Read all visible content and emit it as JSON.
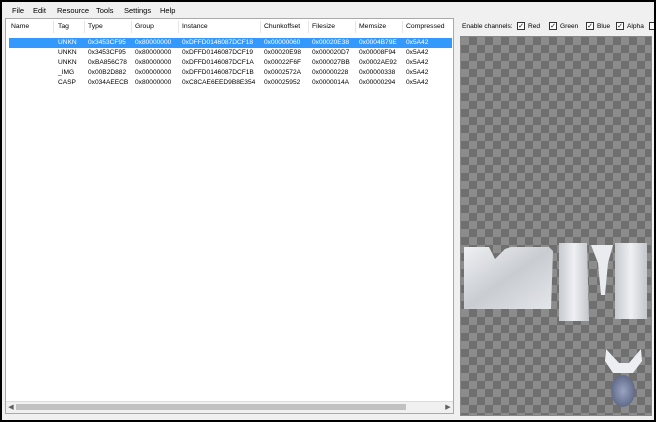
{
  "menu": [
    "File",
    "Edit",
    "Resource",
    "Tools",
    "Settings",
    "Help"
  ],
  "table": {
    "columns": [
      "Name",
      "Tag",
      "Type",
      "Group",
      "Instance",
      "Chunkoffset",
      "Filesize",
      "Memsize",
      "Compressed"
    ],
    "rows": [
      {
        "name": "",
        "tag": "UNKN",
        "type": "0x3453CF95",
        "group": "0x80000000",
        "instance": "0xDFFD0146087DCF18",
        "chunkoffset": "0x00000060",
        "filesize": "0x00020E38",
        "memsize": "0x0004B79E",
        "compressed": "0x5A42",
        "selected": true
      },
      {
        "name": "",
        "tag": "UNKN",
        "type": "0x3453CF95",
        "group": "0x80000000",
        "instance": "0xDFFD0146087DCF19",
        "chunkoffset": "0x00020E98",
        "filesize": "0x000020D7",
        "memsize": "0x00008F94",
        "compressed": "0x5A42",
        "selected": false
      },
      {
        "name": "",
        "tag": "UNKN",
        "type": "0xBA856C78",
        "group": "0x80000000",
        "instance": "0xDFFD0146087DCF1A",
        "chunkoffset": "0x00022F6F",
        "filesize": "0x000027BB",
        "memsize": "0x0002AE92",
        "compressed": "0x5A42",
        "selected": false
      },
      {
        "name": "",
        "tag": "_IMG",
        "type": "0x00B2D882",
        "group": "0x00000000",
        "instance": "0xDFFD0146087DCF1B",
        "chunkoffset": "0x0002572A",
        "filesize": "0x00000228",
        "memsize": "0x00000338",
        "compressed": "0x5A42",
        "selected": false
      },
      {
        "name": "",
        "tag": "CASP",
        "type": "0x034AEECB",
        "group": "0x80000000",
        "instance": "0xC8CAE6EED9B8E354",
        "chunkoffset": "0x00025952",
        "filesize": "0x0000014A",
        "memsize": "0x00000294",
        "compressed": "0x5A42",
        "selected": false
      }
    ]
  },
  "preview": {
    "enable_label": "Enable channels:",
    "channels": [
      {
        "label": "Red",
        "checked": true
      },
      {
        "label": "Green",
        "checked": true
      },
      {
        "label": "Blue",
        "checked": true
      },
      {
        "label": "Alpha",
        "checked": true
      }
    ]
  }
}
